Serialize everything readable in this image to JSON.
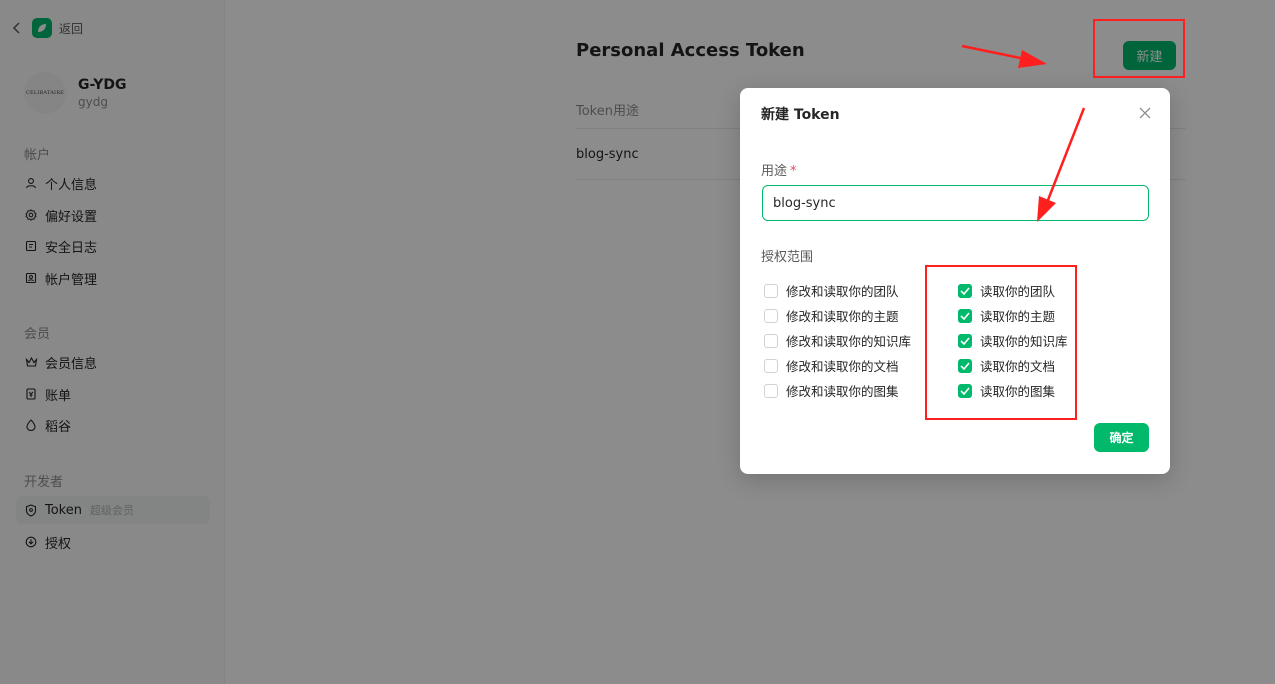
{
  "sidebar": {
    "back_label": "返回",
    "profile": {
      "name": "G-YDG",
      "login": "gydg",
      "avatar_text": "CÉLIBATAIRE"
    },
    "groups": [
      {
        "title": "帐户",
        "items": [
          {
            "label": "个人信息",
            "icon": "user-icon"
          },
          {
            "label": "偏好设置",
            "icon": "gear-icon"
          },
          {
            "label": "安全日志",
            "icon": "log-icon"
          },
          {
            "label": "帐户管理",
            "icon": "account-manage-icon"
          }
        ]
      },
      {
        "title": "会员",
        "items": [
          {
            "label": "会员信息",
            "icon": "crown-icon"
          },
          {
            "label": "账单",
            "icon": "bill-icon"
          },
          {
            "label": "稻谷",
            "icon": "grain-icon"
          }
        ]
      },
      {
        "title": "开发者",
        "items": [
          {
            "label": "Token",
            "icon": "shield-icon",
            "tag": "超级会员"
          },
          {
            "label": "授权",
            "icon": "authorize-icon"
          }
        ]
      }
    ]
  },
  "main": {
    "title": "Personal Access Token",
    "new_button": "新建",
    "table": {
      "header": "Token用途",
      "rows": [
        "blog-sync"
      ]
    }
  },
  "modal": {
    "title": "新建 Token",
    "purpose_label": "用途",
    "required_mark": "*",
    "purpose_value": "blog-sync",
    "scope_label": "授权范围",
    "scopes_write": [
      {
        "label": "修改和读取你的团队",
        "checked": false
      },
      {
        "label": "修改和读取你的主题",
        "checked": false
      },
      {
        "label": "修改和读取你的知识库",
        "checked": false
      },
      {
        "label": "修改和读取你的文档",
        "checked": false
      },
      {
        "label": "修改和读取你的图集",
        "checked": false
      }
    ],
    "scopes_read": [
      {
        "label": "读取你的团队",
        "checked": true
      },
      {
        "label": "读取你的主题",
        "checked": true
      },
      {
        "label": "读取你的知识库",
        "checked": true
      },
      {
        "label": "读取你的文档",
        "checked": true
      },
      {
        "label": "读取你的图集",
        "checked": true
      }
    ],
    "confirm_button": "确定"
  },
  "colors": {
    "accent": "#00b96b",
    "annotation": "#ff1f1f",
    "required": "#e4495b"
  }
}
